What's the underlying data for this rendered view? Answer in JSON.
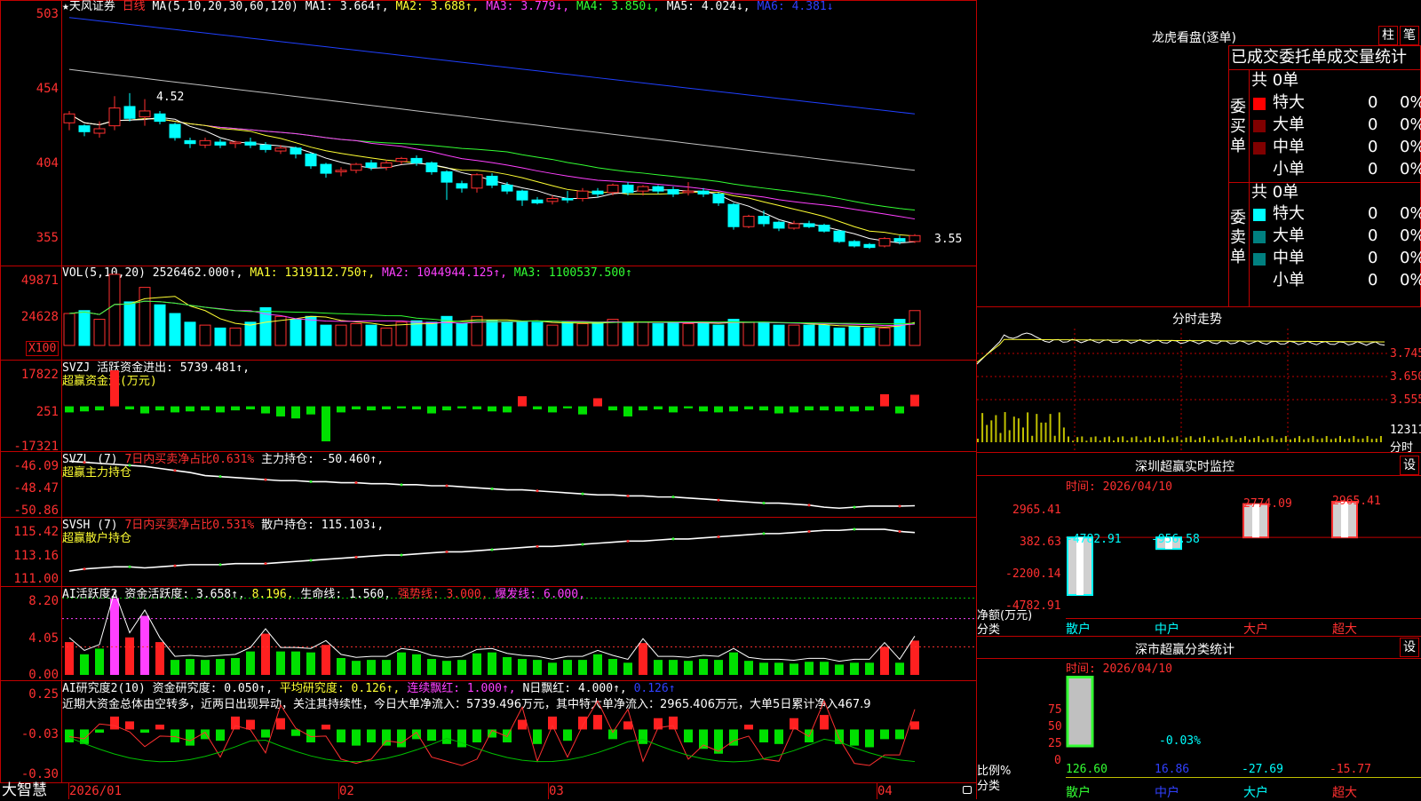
{
  "colors": {
    "up": "#ff3030",
    "down": "#00ffff",
    "ma1": "#ffff33",
    "ma2": "#ff40ff",
    "ma3": "#33ff33",
    "ma4": "#c0c0c0",
    "ma5": "#2040ff",
    "border": "#c00000"
  },
  "main": {
    "stock_name": "★天风证券",
    "period": "日线",
    "ma_params": "MA(5,10,20,30,60,120)",
    "ma1": "MA1: 3.664↑,",
    "ma2": "MA2: 3.688↑,",
    "ma3": "MA3: 3.779↓,",
    "ma4": "MA4: 3.850↓,",
    "ma5": "MA5: 4.024↓,",
    "ma6": "MA6: 4.381↓",
    "axis": [
      "503",
      "454",
      "404",
      "355"
    ],
    "high_label": "4.52",
    "low_label": "3.55"
  },
  "vol": {
    "label": "VOL(5,10,20)",
    "value": "2526462.000↑,",
    "ma1": "MA1: 1319112.750↑,",
    "ma2": "MA2: 1044944.125↑,",
    "ma3": "MA3: 1100537.500↑",
    "axis": [
      "49871",
      "24628"
    ],
    "unit": "X100"
  },
  "svzj": {
    "label": "SVZJ",
    "title": "活跃资金进出: 5739.481↑,",
    "sub": "超赢资金流(万元)",
    "axis": [
      "17822",
      "251",
      "-17321"
    ]
  },
  "svzl": {
    "label": "SVZL (7)",
    "ratio": "7日内买卖净占比0.631%",
    "hold": "主力持仓: -50.460↑,",
    "sub": "超赢主力持仓",
    "axis": [
      "-46.09",
      "-48.47",
      "-50.86"
    ]
  },
  "svsh": {
    "label": "SVSH (7)",
    "ratio": "7日内买卖净占比0.531%",
    "hold": "散户持仓: 115.103↓,",
    "sub": "超赢散户持仓",
    "axis": [
      "115.42",
      "113.16",
      "111.00"
    ]
  },
  "ai1": {
    "label": "AI活跃度2",
    "a": "资金活跃度: 3.658↑,",
    "b": "8.196,",
    "c": "生命线: 1.560,",
    "d": "强势线: 3.000,",
    "e": "爆发线: 6.000,",
    "axis": [
      "8.20",
      "4.05",
      "0.00"
    ]
  },
  "ai2": {
    "label": "AI研究度2(10)",
    "a": "资金研究度: 0.050↑,",
    "b": "平均研究度: 0.126↑,",
    "c": "连续飘红: 1.000↑,",
    "d": "N日飘红: 4.000↑,",
    "e": "0.126↑",
    "text": "近期大资金总体由空转多，近两日出现异动，关注其持续性，今日大单净流入：5739.496万元，其中特大单净流入：2965.406万元，大单5日累计净入467.9",
    "axis": [
      "0.25",
      "-0.03",
      "-0.30"
    ]
  },
  "bottom": {
    "brand": "大智慧",
    "dates": [
      "2026/01",
      "02",
      "03",
      "04"
    ]
  },
  "right": {
    "lhb_title": "龙虎看盘(逐单)",
    "btn1": "柱",
    "btn2": "笔",
    "section_title": "已成交委托单成交量统计",
    "buy_label": "委买单",
    "sell_label": "委卖单",
    "buy_total": "共 0单",
    "sell_total": "共 0单",
    "buy_rows": [
      {
        "name": "特大",
        "count": "0",
        "pct": "0%",
        "color": "#ff0000"
      },
      {
        "name": "大单",
        "count": "0",
        "pct": "0%",
        "color": "#800000"
      },
      {
        "name": "中单",
        "count": "0",
        "pct": "0%",
        "color": "#800000"
      },
      {
        "name": "小单",
        "count": "0",
        "pct": "0%",
        "color": "#000000"
      }
    ],
    "sell_rows": [
      {
        "name": "特大",
        "count": "0",
        "pct": "0%",
        "color": "#00ffff"
      },
      {
        "name": "大单",
        "count": "0",
        "pct": "0%",
        "color": "#008080"
      },
      {
        "name": "中单",
        "count": "0",
        "pct": "0%",
        "color": "#008080"
      },
      {
        "name": "小单",
        "count": "0",
        "pct": "0%",
        "color": "#000000"
      }
    ],
    "fs_title": "分时走势",
    "fs_axis": [
      "3.745",
      "3.650",
      "3.555",
      "12311"
    ],
    "fs_unit": "分时",
    "monitor_title": "深圳超赢实时监控",
    "monitor_btn": "设",
    "monitor_time": "时间: 2026/04/10",
    "monitor_axis": [
      "2965.41",
      "382.63",
      "-2200.14",
      "-4782.91"
    ],
    "monitor_ylabel": "净额(万元)",
    "monitor_xlabel": "分类",
    "monitor_cats": [
      "散户",
      "中户",
      "大户",
      "超大"
    ],
    "monitor_values": [
      "-4782.91",
      "-956.58",
      "2774.09",
      "2965.41"
    ],
    "stat_title": "深市超赢分类统计",
    "stat_btn": "设",
    "stat_time": "时间: 2026/04/10",
    "stat_axis": [
      "75",
      "50",
      "25",
      "0"
    ],
    "stat_ylabel": "比例%",
    "stat_xlabel": "分类",
    "stat_cats": [
      "散户",
      "中户",
      "大户",
      "超大"
    ],
    "stat_values": [
      "126.60",
      "16.86",
      "-27.69",
      "-15.77"
    ],
    "stat_mid_label": "-0.03%"
  },
  "chart_data": [
    {
      "type": "candlestick",
      "title": "天风证券 日线",
      "ylim": [
        3.4,
        5.1
      ],
      "axis_ticks": [
        5.03,
        4.54,
        4.04,
        3.55
      ],
      "candles": [
        [
          4.32,
          4.38,
          4.27,
          4.4
        ],
        [
          4.3,
          4.26,
          4.23,
          4.31
        ],
        [
          4.25,
          4.28,
          4.22,
          4.33
        ],
        [
          4.3,
          4.42,
          4.27,
          4.5
        ],
        [
          4.43,
          4.35,
          4.33,
          4.52
        ],
        [
          4.36,
          4.4,
          4.3,
          4.48
        ],
        [
          4.38,
          4.33,
          4.31,
          4.4
        ],
        [
          4.31,
          4.22,
          4.2,
          4.32
        ],
        [
          4.2,
          4.18,
          4.15,
          4.22
        ],
        [
          4.17,
          4.2,
          4.15,
          4.22
        ],
        [
          4.19,
          4.17,
          4.15,
          4.21
        ],
        [
          4.18,
          4.19,
          4.15,
          4.2
        ],
        [
          4.19,
          4.17,
          4.15,
          4.22
        ],
        [
          4.17,
          4.14,
          4.12,
          4.19
        ],
        [
          4.13,
          4.15,
          4.11,
          4.17
        ],
        [
          4.15,
          4.11,
          4.08,
          4.16
        ],
        [
          4.11,
          4.03,
          4.01,
          4.12
        ],
        [
          4.04,
          3.98,
          3.95,
          4.05
        ],
        [
          3.99,
          4.0,
          3.96,
          4.02
        ],
        [
          4.0,
          4.04,
          3.98,
          4.05
        ],
        [
          4.05,
          4.02,
          4.0,
          4.07
        ],
        [
          4.02,
          4.05,
          4.0,
          4.07
        ],
        [
          4.06,
          4.08,
          4.04,
          4.09
        ],
        [
          4.08,
          4.05,
          4.03,
          4.1
        ],
        [
          4.05,
          3.99,
          3.97,
          4.06
        ],
        [
          3.99,
          3.92,
          3.8,
          4.0
        ],
        [
          3.91,
          3.88,
          3.85,
          3.93
        ],
        [
          3.88,
          3.97,
          3.85,
          3.98
        ],
        [
          3.96,
          3.9,
          3.88,
          3.98
        ],
        [
          3.9,
          3.86,
          3.84,
          3.92
        ],
        [
          3.86,
          3.8,
          3.76,
          3.87
        ],
        [
          3.8,
          3.78,
          3.77,
          3.82
        ],
        [
          3.79,
          3.81,
          3.77,
          3.83
        ],
        [
          3.81,
          3.8,
          3.78,
          3.86
        ],
        [
          3.81,
          3.86,
          3.79,
          3.88
        ],
        [
          3.86,
          3.84,
          3.82,
          3.88
        ],
        [
          3.85,
          3.9,
          3.83,
          3.91
        ],
        [
          3.9,
          3.85,
          3.83,
          3.92
        ],
        [
          3.86,
          3.89,
          3.83,
          3.9
        ],
        [
          3.89,
          3.86,
          3.84,
          3.9
        ],
        [
          3.87,
          3.84,
          3.82,
          3.89
        ],
        [
          3.85,
          3.86,
          3.83,
          3.92
        ],
        [
          3.86,
          3.84,
          3.82,
          3.88
        ],
        [
          3.84,
          3.78,
          3.76,
          3.85
        ],
        [
          3.77,
          3.62,
          3.6,
          3.78
        ],
        [
          3.62,
          3.69,
          3.61,
          3.7
        ],
        [
          3.69,
          3.64,
          3.62,
          3.73
        ],
        [
          3.65,
          3.61,
          3.59,
          3.66
        ],
        [
          3.61,
          3.64,
          3.6,
          3.66
        ],
        [
          3.64,
          3.62,
          3.61,
          3.66
        ],
        [
          3.63,
          3.59,
          3.58,
          3.64
        ],
        [
          3.59,
          3.52,
          3.51,
          3.6
        ],
        [
          3.52,
          3.49,
          3.48,
          3.53
        ],
        [
          3.5,
          3.48,
          3.47,
          3.51
        ],
        [
          3.49,
          3.54,
          3.48,
          3.55
        ],
        [
          3.54,
          3.52,
          3.5,
          3.56
        ],
        [
          3.52,
          3.56,
          3.51,
          3.57
        ]
      ]
    },
    {
      "type": "bar",
      "title": "VOL(5,10,20)",
      "unit": "X100",
      "ylim": [
        0,
        52000
      ],
      "values": [
        22000,
        24000,
        18000,
        49000,
        30000,
        40000,
        28000,
        22000,
        16000,
        14000,
        12000,
        12000,
        16000,
        26000,
        20000,
        18000,
        20000,
        14000,
        14000,
        15000,
        14000,
        12000,
        16000,
        17000,
        16000,
        20000,
        15000,
        20000,
        17000,
        16000,
        16000,
        16000,
        14000,
        16000,
        15000,
        16000,
        18000,
        16000,
        16000,
        15000,
        16000,
        15000,
        16000,
        14000,
        18000,
        16000,
        16000,
        14000,
        14000,
        14000,
        14000,
        12000,
        13000,
        12000,
        12000,
        18000,
        24000
      ]
    },
    {
      "type": "bar",
      "title": "SVZJ 活跃资金进出",
      "ylim": [
        -17321,
        17822
      ],
      "values": [
        -3000,
        -2500,
        -2000,
        17822,
        -1500,
        -3500,
        -2000,
        -3000,
        -2500,
        -2000,
        -3000,
        -2000,
        -1500,
        -3500,
        -5000,
        -6000,
        -4000,
        -17321,
        -3000,
        -1500,
        -2000,
        -1500,
        -1000,
        -1500,
        -3500,
        -2000,
        -1000,
        -1500,
        -2500,
        -3000,
        5000,
        -1500,
        -3000,
        -1000,
        -4000,
        4000,
        -2000,
        -5000,
        -2000,
        -1500,
        -3000,
        -1000,
        -2500,
        -3000,
        -2500,
        -1500,
        -2000,
        -3500,
        -3000,
        -2000,
        -2000,
        -2500,
        -2500,
        -2000,
        6000,
        -3500,
        5739
      ]
    },
    {
      "type": "line",
      "title": "SVZL 主力持仓",
      "ylim": [
        -51.2,
        -45.8
      ],
      "values": [
        -46.1,
        -46.2,
        -46.3,
        -46.4,
        -46.5,
        -46.6,
        -46.8,
        -47.0,
        -47.2,
        -47.5,
        -47.6,
        -47.7,
        -47.8,
        -47.9,
        -48.0,
        -48.0,
        -48.1,
        -48.1,
        -48.2,
        -48.2,
        -48.3,
        -48.3,
        -48.4,
        -48.4,
        -48.5,
        -48.5,
        -48.6,
        -48.7,
        -48.8,
        -48.9,
        -48.9,
        -49.0,
        -49.1,
        -49.2,
        -49.3,
        -49.4,
        -49.4,
        -49.5,
        -49.5,
        -49.6,
        -49.6,
        -49.7,
        -49.8,
        -49.9,
        -50.0,
        -50.1,
        -50.2,
        -50.2,
        -50.3,
        -50.4,
        -50.6,
        -50.7,
        -50.6,
        -50.5,
        -50.5,
        -50.5,
        -50.46
      ]
    },
    {
      "type": "line",
      "title": "SVSH 散户持仓",
      "ylim": [
        110.6,
        115.9
      ],
      "values": [
        111.5,
        111.7,
        111.8,
        111.9,
        111.9,
        111.8,
        111.9,
        112.0,
        112.1,
        112.1,
        112.1,
        112.2,
        112.2,
        112.2,
        112.3,
        112.4,
        112.5,
        112.6,
        112.7,
        112.8,
        112.9,
        113.0,
        113.0,
        113.1,
        113.2,
        113.3,
        113.3,
        113.4,
        113.5,
        113.6,
        113.7,
        113.8,
        113.8,
        113.9,
        114.0,
        114.1,
        114.2,
        114.3,
        114.3,
        114.4,
        114.5,
        114.5,
        114.6,
        114.7,
        114.8,
        114.9,
        115.0,
        115.0,
        115.1,
        115.2,
        115.3,
        115.3,
        115.4,
        115.4,
        115.4,
        115.2,
        115.1
      ]
    },
    {
      "type": "bar",
      "title": "AI活跃度2",
      "ylim": [
        0,
        9
      ],
      "values": [
        3.5,
        2.2,
        2.8,
        8.2,
        4.0,
        6.3,
        3.5,
        1.6,
        1.7,
        1.6,
        1.7,
        1.8,
        2.5,
        4.4,
        2.5,
        2.5,
        2.4,
        3.2,
        1.8,
        1.5,
        1.6,
        1.6,
        2.4,
        2.2,
        1.7,
        1.5,
        1.6,
        2.3,
        2.4,
        1.9,
        1.7,
        1.6,
        1.3,
        1.6,
        1.6,
        2.2,
        1.7,
        1.3,
        3.4,
        1.6,
        1.6,
        1.5,
        1.7,
        1.6,
        2.4,
        1.5,
        1.3,
        1.3,
        1.2,
        1.4,
        1.4,
        1.1,
        1.3,
        1.3,
        3.0,
        1.3,
        3.658
      ]
    },
    {
      "type": "bar",
      "title": "AI研究度2(10)",
      "ylim": [
        -0.3,
        0.25
      ],
      "values": [
        -0.08,
        -0.09,
        -0.02,
        0.08,
        0.05,
        -0.02,
        0.03,
        -0.08,
        -0.1,
        -0.06,
        -0.07,
        0.08,
        0.06,
        -0.05,
        0.07,
        -0.04,
        -0.08,
        0.03,
        -0.08,
        -0.1,
        -0.08,
        -0.1,
        -0.11,
        -0.06,
        -0.07,
        -0.09,
        -0.11,
        -0.08,
        -0.05,
        -0.08,
        0.06,
        -0.09,
        0.08,
        -0.07,
        0.08,
        0.09,
        -0.06,
        0.05,
        -0.09,
        0.07,
        0.08,
        -0.08,
        -0.12,
        -0.15,
        -0.1,
        0.03,
        -0.08,
        -0.09,
        0.07,
        -0.08,
        0.09,
        -0.09,
        -0.1,
        -0.11,
        -0.06,
        -0.06,
        0.05
      ]
    }
  ]
}
